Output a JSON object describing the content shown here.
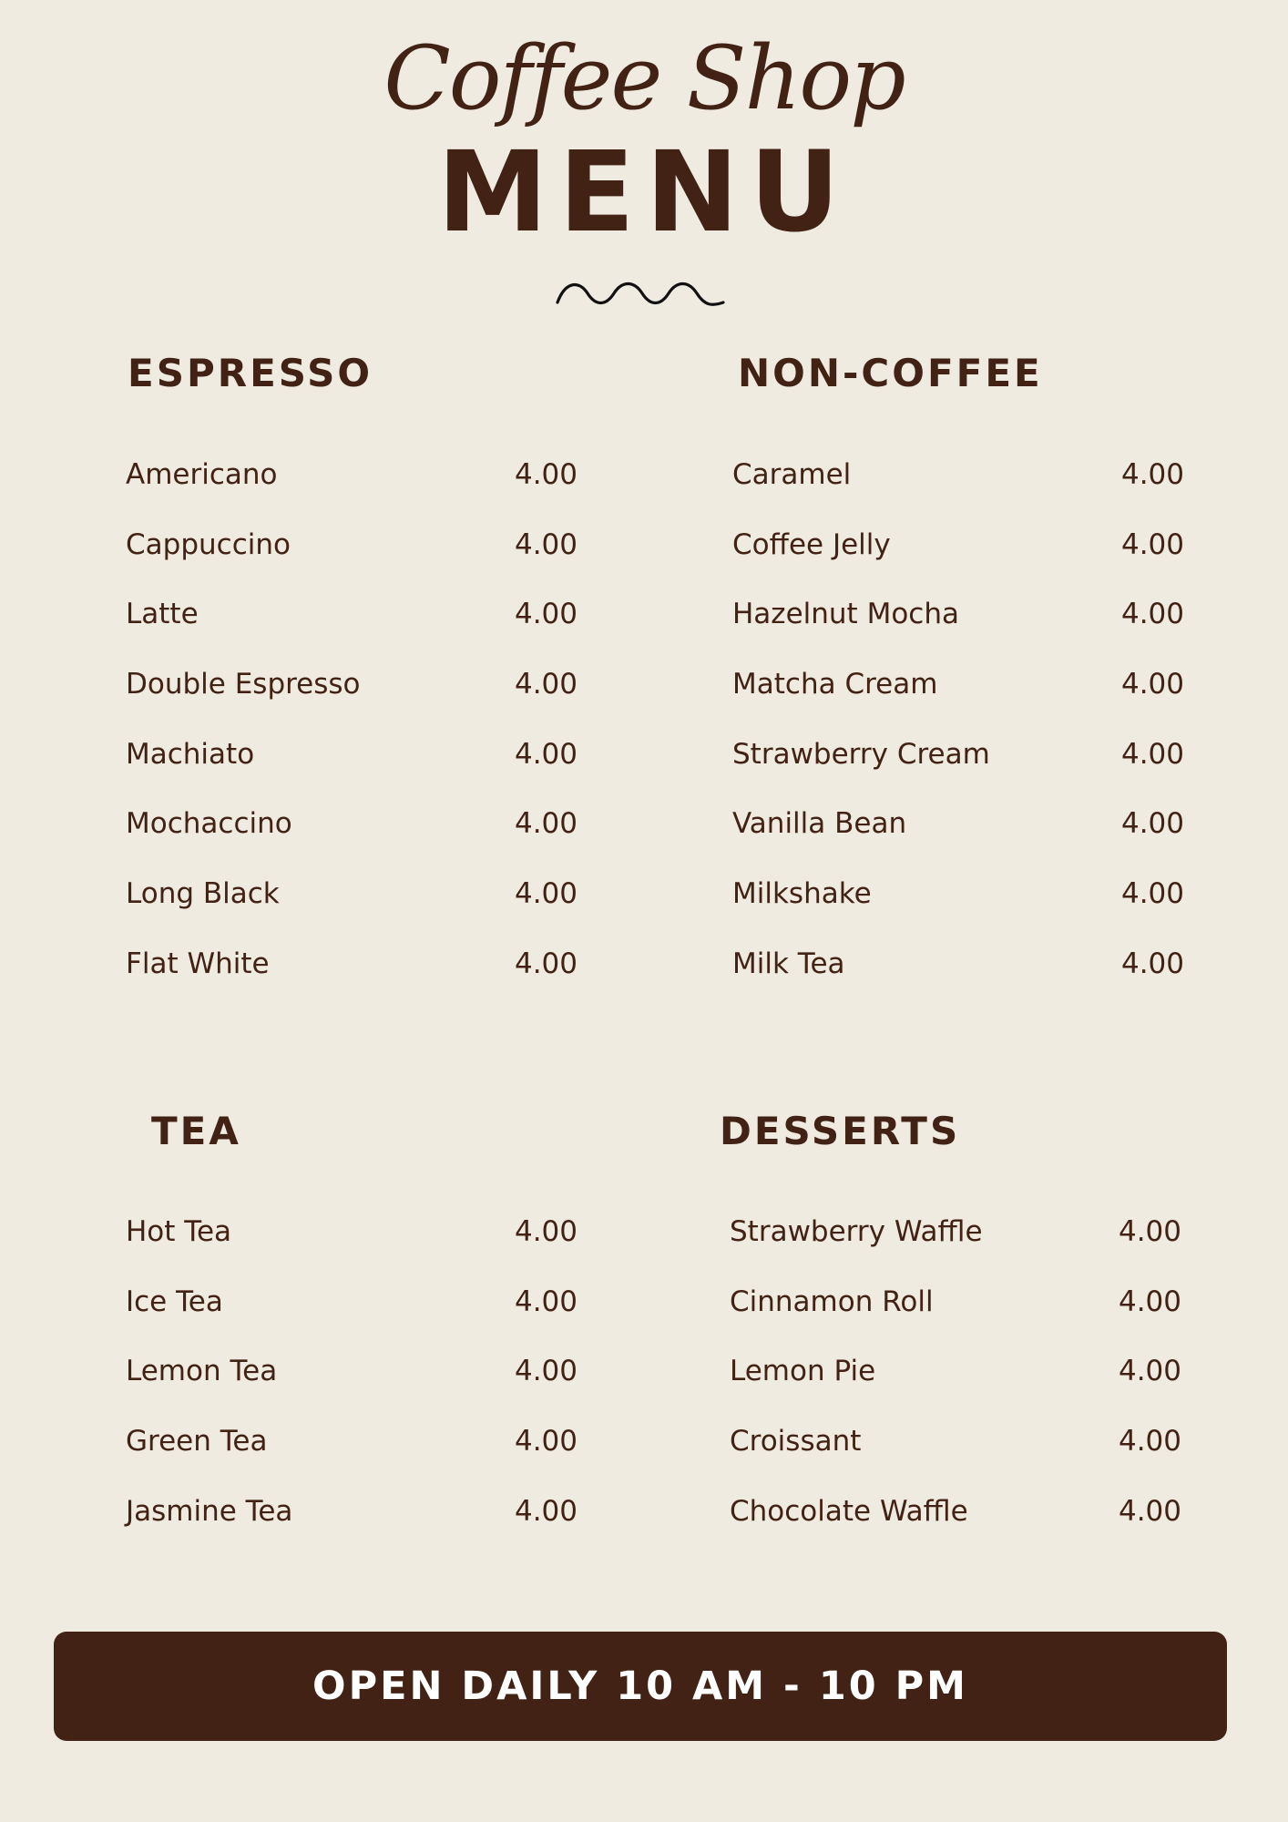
{
  "header": {
    "script_title": "Coffee Shop",
    "main_title": "MENU"
  },
  "sections": [
    {
      "id": "espresso",
      "heading": "ESPRESSO",
      "items": [
        {
          "name": "Americano",
          "price": "4.00"
        },
        {
          "name": "Cappuccino",
          "price": "4.00"
        },
        {
          "name": "Latte",
          "price": "4.00"
        },
        {
          "name": "Double Espresso",
          "price": "4.00"
        },
        {
          "name": "Machiato",
          "price": "4.00"
        },
        {
          "name": "Mochaccino",
          "price": "4.00"
        },
        {
          "name": "Long Black",
          "price": "4.00"
        },
        {
          "name": "Flat White",
          "price": "4.00"
        }
      ]
    },
    {
      "id": "non-coffee",
      "heading": "NON-COFFEE",
      "items": [
        {
          "name": "Caramel",
          "price": "4.00"
        },
        {
          "name": "Coffee Jelly",
          "price": "4.00"
        },
        {
          "name": "Hazelnut Mocha",
          "price": "4.00"
        },
        {
          "name": "Matcha Cream",
          "price": "4.00"
        },
        {
          "name": "Strawberry Cream",
          "price": "4.00"
        },
        {
          "name": "Vanilla Bean",
          "price": "4.00"
        },
        {
          "name": "Milkshake",
          "price": "4.00"
        },
        {
          "name": "Milk Tea",
          "price": "4.00"
        }
      ]
    },
    {
      "id": "tea",
      "heading": "TEA",
      "items": [
        {
          "name": "Hot Tea",
          "price": "4.00"
        },
        {
          "name": "Ice Tea",
          "price": "4.00"
        },
        {
          "name": "Lemon Tea",
          "price": "4.00"
        },
        {
          "name": "Green Tea",
          "price": "4.00"
        },
        {
          "name": "Jasmine Tea",
          "price": "4.00"
        }
      ]
    },
    {
      "id": "desserts",
      "heading": "DESSERTS",
      "items": [
        {
          "name": "Strawberry Waffle",
          "price": "4.00"
        },
        {
          "name": "Cinnamon Roll",
          "price": "4.00"
        },
        {
          "name": "Lemon Pie",
          "price": "4.00"
        },
        {
          "name": "Croissant",
          "price": "4.00"
        },
        {
          "name": "Chocolate Waffle",
          "price": "4.00"
        }
      ]
    }
  ],
  "footer": {
    "hours": "OPEN DAILY 10 AM - 10 PM"
  },
  "colors": {
    "background": "#efebe0",
    "brown": "#422214",
    "footer_text": "#ffffff"
  }
}
